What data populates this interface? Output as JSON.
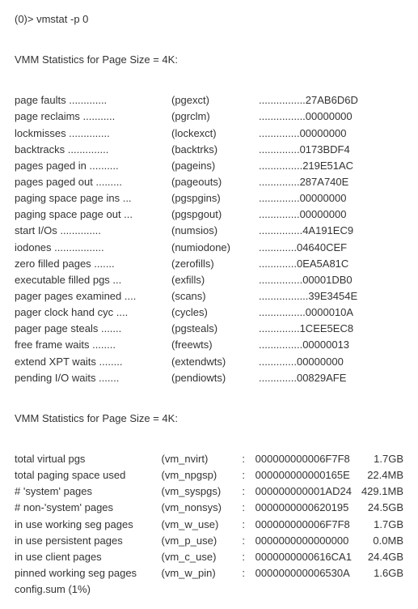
{
  "prompt": "(0)> vmstat -p 0",
  "header1": "VMM Statistics for Page Size =  4K:",
  "header2": "VMM Statistics for Page Size =  4K:",
  "footer": "config.sum (1%)",
  "rows1": [
    {
      "label": "page faults .............",
      "short": "(pgexct)",
      "dots": "................",
      "value": "27AB6D6D"
    },
    {
      "label": "page reclaims ...........",
      "short": "(pgrclm)",
      "dots": "................",
      "value": "00000000"
    },
    {
      "label": "lockmisses ..............",
      "short": "(lockexct)",
      "dots": "..............",
      "value": "00000000"
    },
    {
      "label": "backtracks ..............",
      "short": "(backtrks)",
      "dots": "..............",
      "value": "0173BDF4"
    },
    {
      "label": "pages paged in ..........",
      "short": "(pageins)",
      "dots": "...............",
      "value": "219E51AC"
    },
    {
      "label": "pages paged out .........",
      "short": "(pageouts)",
      "dots": "..............",
      "value": "287A740E"
    },
    {
      "label": "paging space page ins ...",
      "short": "(pgspgins)",
      "dots": "..............",
      "value": "00000000"
    },
    {
      "label": "paging space page out ...",
      "short": "(pgspgout)",
      "dots": "..............",
      "value": "00000000"
    },
    {
      "label": "start I/Os ..............",
      "short": "(numsios)",
      "dots": "...............",
      "value": "4A191EC9"
    },
    {
      "label": "iodones .................",
      "short": "(numiodone)",
      "dots": ".............",
      "value": "04640CEF"
    },
    {
      "label": "zero filled pages .......",
      "short": "(zerofills)",
      "dots": ".............",
      "value": "0EA5A81C"
    },
    {
      "label": "executable filled pgs ...",
      "short": "(exfills)",
      "dots": "...............",
      "value": "00001DB0"
    },
    {
      "label": "pager pages examined ....",
      "short": "(scans)",
      "dots": ".................",
      "value": "39E3454E"
    },
    {
      "label": "pager clock hand cyc ....",
      "short": "(cycles)",
      "dots": "................",
      "value": "0000010A"
    },
    {
      "label": "pager page steals .......",
      "short": "(pgsteals)",
      "dots": "..............",
      "value": "1CEE5EC8"
    },
    {
      "label": "free frame waits ........",
      "short": "(freewts)",
      "dots": "...............",
      "value": "00000013"
    },
    {
      "label": "extend XPT waits ........",
      "short": "(extendwts)",
      "dots": ".............",
      "value": "00000000"
    },
    {
      "label": "pending I/O waits .......",
      "short": "(pendiowts)",
      "dots": ".............",
      "value": "00829AFE"
    }
  ],
  "rows2": [
    {
      "label": "total virtual pgs",
      "short": "(vm_nvirt)",
      "hex": "000000000006F7F8",
      "size": "1.7GB"
    },
    {
      "label": "total paging space used",
      "short": "(vm_npgsp)",
      "hex": "000000000000165E",
      "size": "22.4MB"
    },
    {
      "label": "# 'system' pages",
      "short": "(vm_syspgs)",
      "hex": "000000000001AD24",
      "size": "429.1MB"
    },
    {
      "label": "# non-'system' pages",
      "short": "(vm_nonsys)",
      "hex": "0000000000620195",
      "size": "24.5GB"
    },
    {
      "label": "in use working seg pages",
      "short": "(vm_w_use)",
      "hex": "000000000006F7F8",
      "size": "1.7GB"
    },
    {
      "label": "in use persistent pages",
      "short": "(vm_p_use)",
      "hex": "0000000000000000",
      "size": "0.0MB"
    },
    {
      "label": "in use client pages",
      "short": "(vm_c_use)",
      "hex": "0000000000616CA1",
      "size": "24.4GB"
    },
    {
      "label": "pinned working seg pages",
      "short": "(vm_w_pin)",
      "hex": "000000000006530A",
      "size": "1.6GB"
    }
  ]
}
